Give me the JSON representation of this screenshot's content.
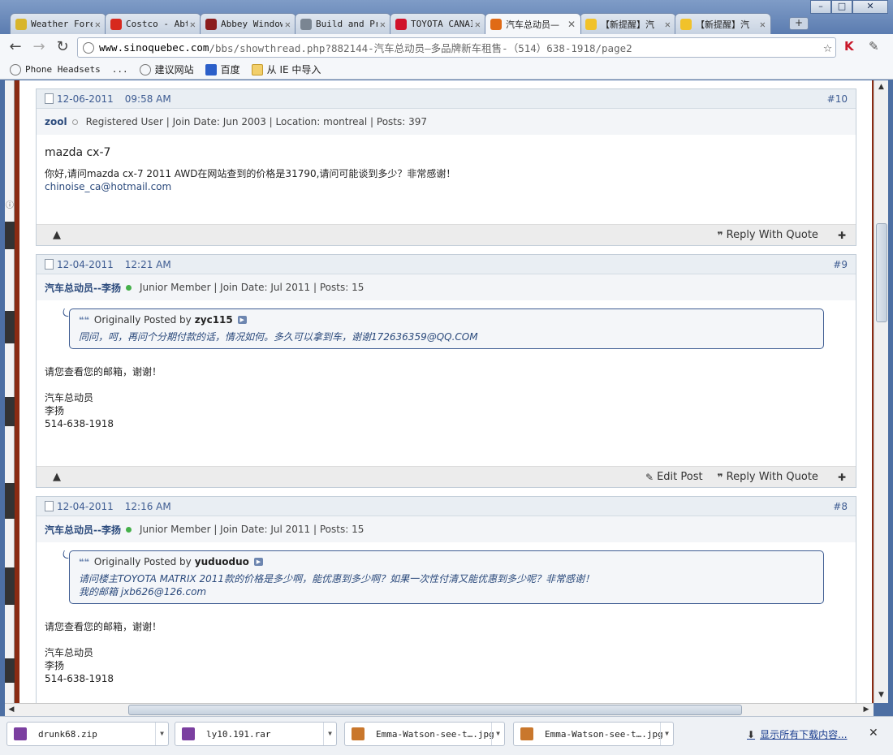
{
  "window": {
    "minimize": "–",
    "maximize": "□",
    "close": "✕"
  },
  "tabs": [
    {
      "label": "Weather Fore",
      "color": "#d8b52c",
      "active": false
    },
    {
      "label": "Costco - Abt",
      "color": "#d7291e",
      "active": false
    },
    {
      "label": "Abbey Window",
      "color": "#8b1d1d",
      "active": false
    },
    {
      "label": "Build and Pr",
      "color": "#7a8592",
      "active": false
    },
    {
      "label": "TOYOTA CANAI",
      "color": "#d0122b",
      "active": false
    },
    {
      "label": "汽车总动员—",
      "color": "#e06a16",
      "active": true
    },
    {
      "label": "【新提醒】汽",
      "color": "#f1c22a",
      "active": false
    },
    {
      "label": "【新提醒】汽",
      "color": "#f1c22a",
      "active": false
    }
  ],
  "toolbar": {
    "back": "←",
    "forward": "→",
    "reload": "↻",
    "url_host": "www.sinoquebec.com",
    "url_rest": "/bbs/showthread.php?882144-汽车总动员—多品牌新车租售-（514）638-1918/page2",
    "star": "☆"
  },
  "bookmarks": [
    {
      "label": "Phone Headsets",
      "mono": true
    },
    {
      "label": "...",
      "mono": true
    },
    {
      "label": "建议网站",
      "mono": false
    },
    {
      "label": "百度",
      "mono": false
    },
    {
      "label": "从 IE 中导入",
      "mono": false
    }
  ],
  "posts": [
    {
      "date": "12-06-2011",
      "time": "09:58 AM",
      "postno": "#10",
      "username": "zool",
      "online": false,
      "userinfo": "Registered User | Join Date: Jun 2003 | Location: montreal | Posts: 397",
      "title": "mazda cx-7",
      "lines": [
        "你好,请问mazda cx-7 2011 AWD在网站查到的价格是31790,请问可能谈到多少？非常感谢！",
        "chinoise_ca@hotmail.com"
      ],
      "footer": {
        "edit": "",
        "reply": "Reply With Quote",
        "warn": "▲",
        "multi": "✚"
      }
    },
    {
      "date": "12-04-2011",
      "time": "12:21 AM",
      "postno": "#9",
      "username": "汽车总动员--李扬",
      "online": true,
      "userinfo": "Junior Member | Join Date: Jul 2011 | Posts: 15",
      "quote": {
        "label": "Originally Posted by",
        "author": "zyc115",
        "lines": [
          "同问，呵，再问个分期付款的话，情况如何。多久可以拿到车，谢谢172636359@QQ.COM"
        ]
      },
      "lines": [
        "请您查看您的邮箱，谢谢！",
        "",
        "汽车总动员",
        "李扬",
        "514-638-1918"
      ],
      "footer": {
        "edit": "Edit Post",
        "reply": "Reply With Quote",
        "warn": "▲",
        "multi": "✚"
      }
    },
    {
      "date": "12-04-2011",
      "time": "12:16 AM",
      "postno": "#8",
      "username": "汽车总动员--李扬",
      "online": true,
      "userinfo": "Junior Member | Join Date: Jul 2011 | Posts: 15",
      "quote": {
        "label": "Originally Posted by",
        "author": "yuduoduo",
        "lines": [
          "请问楼主TOYOTA MATRIX 2011款的价格是多少啊，能优惠到多少啊？如果一次性付清又能优惠到多少呢？非常感谢！",
          "我的邮箱 jxb626@126.com"
        ]
      },
      "lines": [
        "请您查看您的邮箱，谢谢！",
        "",
        "汽车总动员",
        "李扬",
        "514-638-1918"
      ]
    }
  ],
  "downloads": [
    {
      "name": "drunk68.zip",
      "color": "#7b3fa0"
    },
    {
      "name": "ly10.191.rar",
      "color": "#7b3fa0"
    },
    {
      "name": "Emma-Watson-see-t….jpg",
      "color": "#c9772c"
    },
    {
      "name": "Emma-Watson-see-t….jpg",
      "color": "#c9772c"
    }
  ],
  "downloads_bar": {
    "show_all": "显示所有下载内容...",
    "close": "✕"
  }
}
